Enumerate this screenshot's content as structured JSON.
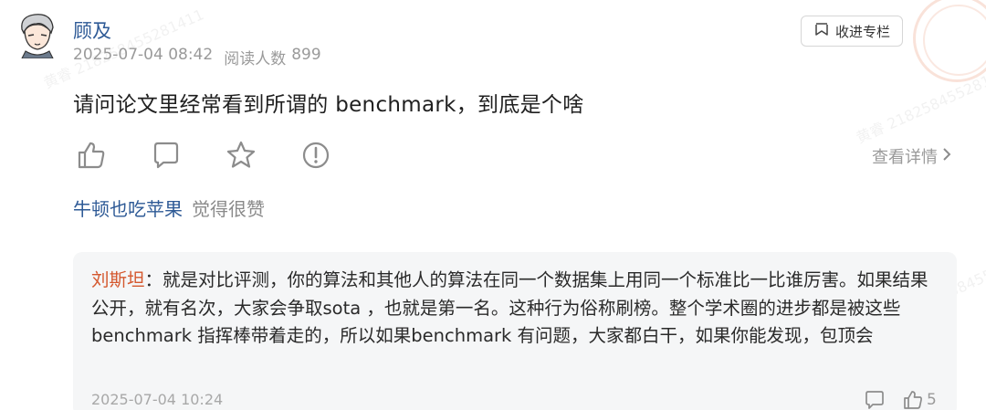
{
  "post": {
    "author": "顾及",
    "date": "2025-07-04 08:42",
    "reads_label": "阅读人数",
    "reads_count": "899",
    "follow_label": "收进专栏",
    "question": "请问论文里经常看到所谓的 benchmark，到底是个啥",
    "detail_label": "查看详情"
  },
  "likes": {
    "name": "牛顿也吃苹果",
    "text": "觉得很赞"
  },
  "reply": {
    "author": "刘斯坦",
    "separator": "：",
    "text": "就是对比评测，你的算法和其他人的算法在同一个数据集上用同一个标准比一比谁厉害。如果结果公开，就有名次，大家会争取sota ，也就是第一名。这种行为俗称刷榜。整个学术圈的进步都是被这些benchmark 指挥棒带着走的，所以如果benchmark 有问题，大家都白干，如果你能发现，包顶会",
    "time": "2025-07-04 10:24",
    "like_count": "5"
  },
  "icons": {
    "actions": [
      "thumbs-up-icon",
      "comment-icon",
      "star-icon",
      "report-icon"
    ],
    "follow": "bookmark-icon",
    "detail": "chevron-right-icon"
  },
  "watermark": "黄睿 218258455281411",
  "colors": {
    "name_blue": "#2e5a96",
    "reply_author": "#d4572d",
    "muted": "#9a9a9a",
    "card_bg": "#f5f6f7"
  }
}
